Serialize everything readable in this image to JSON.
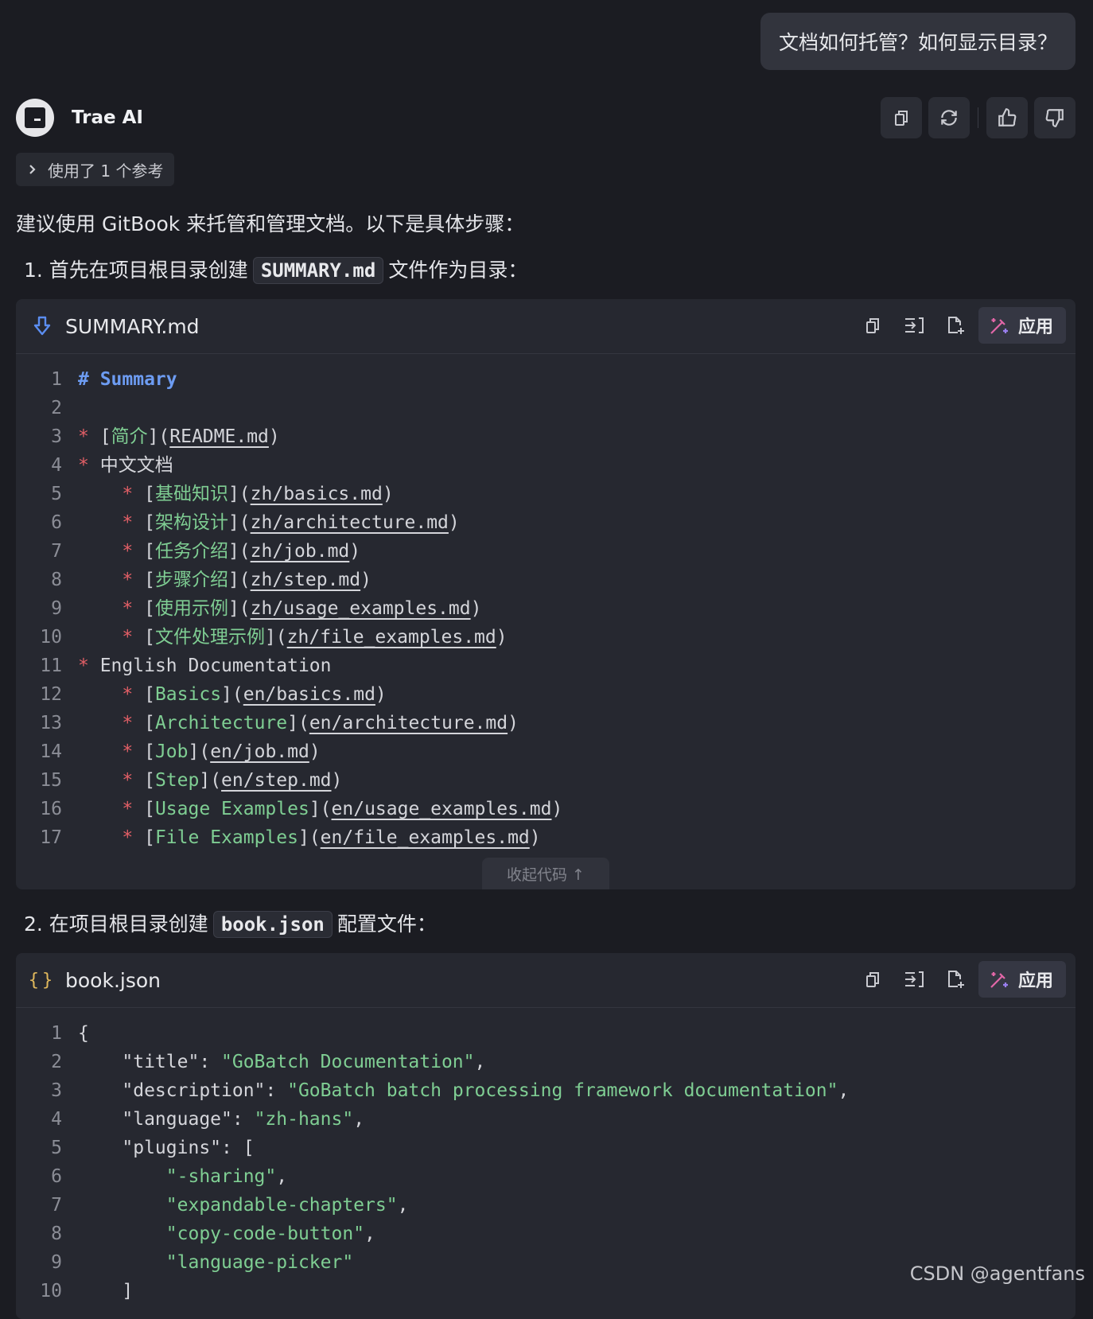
{
  "user_message": "文档如何托管？如何显示目录？",
  "assistant": {
    "name": "Trae AI",
    "actions": [
      "copy-icon",
      "regenerate-icon",
      "thumbs-up-icon",
      "thumbs-down-icon"
    ],
    "references_label": "使用了 1 个参考",
    "intro": "建议使用 GitBook 来托管和管理文档。以下是具体步骤："
  },
  "step1": {
    "prefix": "1. 首先在项目根目录创建",
    "code": "SUMMARY.md",
    "suffix": "文件作为目录："
  },
  "block1": {
    "file_name": "SUMMARY.md",
    "file_icon": "download-arrow-icon",
    "apply_label": "应用",
    "collapse_label": "收起代码 ↑",
    "lines": [
      [
        {
          "t": "# Summary",
          "c": "t-head"
        }
      ],
      [],
      [
        {
          "t": "* ",
          "c": "t-star"
        },
        {
          "t": "["
        },
        {
          "t": "简介",
          "c": "t-link"
        },
        {
          "t": "]("
        },
        {
          "t": "README.md",
          "c": "t-url"
        },
        {
          "t": ")"
        }
      ],
      [
        {
          "t": "* ",
          "c": "t-star"
        },
        {
          "t": "中文文档"
        }
      ],
      [
        {
          "t": "    * ",
          "c": "t-star"
        },
        {
          "t": "["
        },
        {
          "t": "基础知识",
          "c": "t-link"
        },
        {
          "t": "]("
        },
        {
          "t": "zh/basics.md",
          "c": "t-url"
        },
        {
          "t": ")"
        }
      ],
      [
        {
          "t": "    * ",
          "c": "t-star"
        },
        {
          "t": "["
        },
        {
          "t": "架构设计",
          "c": "t-link"
        },
        {
          "t": "]("
        },
        {
          "t": "zh/architecture.md",
          "c": "t-url"
        },
        {
          "t": ")"
        }
      ],
      [
        {
          "t": "    * ",
          "c": "t-star"
        },
        {
          "t": "["
        },
        {
          "t": "任务介绍",
          "c": "t-link"
        },
        {
          "t": "]("
        },
        {
          "t": "zh/job.md",
          "c": "t-url"
        },
        {
          "t": ")"
        }
      ],
      [
        {
          "t": "    * ",
          "c": "t-star"
        },
        {
          "t": "["
        },
        {
          "t": "步骤介绍",
          "c": "t-link"
        },
        {
          "t": "]("
        },
        {
          "t": "zh/step.md",
          "c": "t-url"
        },
        {
          "t": ")"
        }
      ],
      [
        {
          "t": "    * ",
          "c": "t-star"
        },
        {
          "t": "["
        },
        {
          "t": "使用示例",
          "c": "t-link"
        },
        {
          "t": "]("
        },
        {
          "t": "zh/usage_examples.md",
          "c": "t-url"
        },
        {
          "t": ")"
        }
      ],
      [
        {
          "t": "    * ",
          "c": "t-star"
        },
        {
          "t": "["
        },
        {
          "t": "文件处理示例",
          "c": "t-link"
        },
        {
          "t": "]("
        },
        {
          "t": "zh/file_examples.md",
          "c": "t-url"
        },
        {
          "t": ")"
        }
      ],
      [
        {
          "t": "* ",
          "c": "t-star"
        },
        {
          "t": "English Documentation"
        }
      ],
      [
        {
          "t": "    * ",
          "c": "t-star"
        },
        {
          "t": "["
        },
        {
          "t": "Basics",
          "c": "t-link"
        },
        {
          "t": "]("
        },
        {
          "t": "en/basics.md",
          "c": "t-url"
        },
        {
          "t": ")"
        }
      ],
      [
        {
          "t": "    * ",
          "c": "t-star"
        },
        {
          "t": "["
        },
        {
          "t": "Architecture",
          "c": "t-link"
        },
        {
          "t": "]("
        },
        {
          "t": "en/architecture.md",
          "c": "t-url"
        },
        {
          "t": ")"
        }
      ],
      [
        {
          "t": "    * ",
          "c": "t-star"
        },
        {
          "t": "["
        },
        {
          "t": "Job",
          "c": "t-link"
        },
        {
          "t": "]("
        },
        {
          "t": "en/job.md",
          "c": "t-url"
        },
        {
          "t": ")"
        }
      ],
      [
        {
          "t": "    * ",
          "c": "t-star"
        },
        {
          "t": "["
        },
        {
          "t": "Step",
          "c": "t-link"
        },
        {
          "t": "]("
        },
        {
          "t": "en/step.md",
          "c": "t-url"
        },
        {
          "t": ")"
        }
      ],
      [
        {
          "t": "    * ",
          "c": "t-star"
        },
        {
          "t": "["
        },
        {
          "t": "Usage Examples",
          "c": "t-link"
        },
        {
          "t": "]("
        },
        {
          "t": "en/usage_examples.md",
          "c": "t-url"
        },
        {
          "t": ")"
        }
      ],
      [
        {
          "t": "    * ",
          "c": "t-star"
        },
        {
          "t": "["
        },
        {
          "t": "File Examples",
          "c": "t-link"
        },
        {
          "t": "]("
        },
        {
          "t": "en/file_examples.md",
          "c": "t-url"
        },
        {
          "t": ")"
        }
      ]
    ]
  },
  "step2": {
    "prefix": "2. 在项目根目录创建",
    "code": "book.json",
    "suffix": "配置文件："
  },
  "block2": {
    "file_name": "book.json",
    "file_icon": "braces-icon",
    "apply_label": "应用",
    "lines": [
      [
        {
          "t": "{"
        }
      ],
      [
        {
          "t": "    \"title\": "
        },
        {
          "t": "\"GoBatch Documentation\"",
          "c": "t-str"
        },
        {
          "t": ","
        }
      ],
      [
        {
          "t": "    \"description\": "
        },
        {
          "t": "\"GoBatch batch processing framework documentation\"",
          "c": "t-str"
        },
        {
          "t": ","
        }
      ],
      [
        {
          "t": "    \"language\": "
        },
        {
          "t": "\"zh-hans\"",
          "c": "t-str"
        },
        {
          "t": ","
        }
      ],
      [
        {
          "t": "    \"plugins\": ["
        }
      ],
      [
        {
          "t": "        "
        },
        {
          "t": "\"-sharing\"",
          "c": "t-str"
        },
        {
          "t": ","
        }
      ],
      [
        {
          "t": "        "
        },
        {
          "t": "\"expandable-chapters\"",
          "c": "t-str"
        },
        {
          "t": ","
        }
      ],
      [
        {
          "t": "        "
        },
        {
          "t": "\"copy-code-button\"",
          "c": "t-str"
        },
        {
          "t": ","
        }
      ],
      [
        {
          "t": "        "
        },
        {
          "t": "\"language-picker\"",
          "c": "t-str"
        }
      ],
      [
        {
          "t": "    ]"
        }
      ]
    ]
  },
  "watermark": "CSDN @agentfans"
}
